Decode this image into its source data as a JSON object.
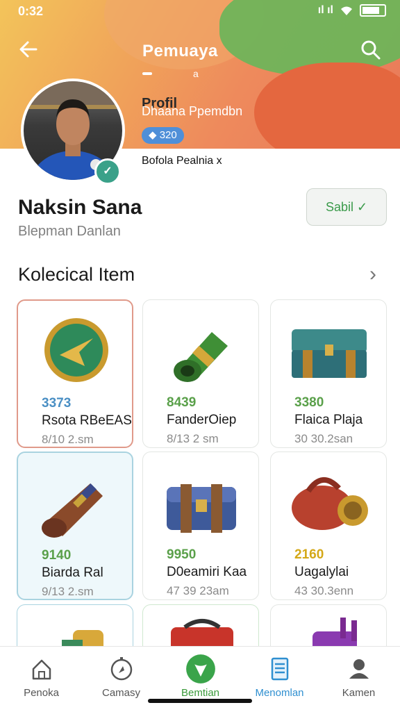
{
  "statusbar": {
    "time": "0:32",
    "signal_text": "ıl ıl"
  },
  "header": {
    "title": "Pemuaya",
    "small_mark": "a",
    "profile_title": "Profil",
    "profile_subtitle": "Dhaana Ppemdbn",
    "level": "320",
    "team_text": "Bofola Pealnia x"
  },
  "profile": {
    "name": "Naksin Sana",
    "role": "Blepman Danlan",
    "save_label": "Sabil ✓"
  },
  "section": {
    "title": "Kolecical Item"
  },
  "items": [
    {
      "price": "3373",
      "title": "Rsota RBeEAS",
      "meta": "8/10 2.sm",
      "price_color": "#4a8fc4"
    },
    {
      "price": "8439",
      "title": "FanderOiep",
      "meta": "8/13 2 sm",
      "price_color": "#5aa04a"
    },
    {
      "price": "3380",
      "title": "Flaica Plaja",
      "meta": "30 30.2san",
      "price_color": "#5aa04a"
    },
    {
      "price": "9140",
      "title": "Biarda Ral",
      "meta": "9/13 2.sm",
      "price_color": "#5aa04a"
    },
    {
      "price": "9950",
      "title": "D0eamiri Kaa",
      "meta": "47 39 23am",
      "price_color": "#5aa04a"
    },
    {
      "price": "2160",
      "title": "Uagalylai",
      "meta": "43 30.3enn",
      "price_color": "#d4a817"
    }
  ],
  "nav": [
    {
      "label": "Penoka",
      "icon": "home-icon"
    },
    {
      "label": "Camasy",
      "icon": "compass-icon"
    },
    {
      "label": "Bemtian",
      "icon": "shield-icon",
      "active": true
    },
    {
      "label": "Menomlan",
      "icon": "document-icon"
    },
    {
      "label": "Kamen",
      "icon": "person-icon"
    }
  ],
  "colors": {
    "accent_green": "#3aa44a",
    "accent_blue": "#2f8fd0"
  }
}
